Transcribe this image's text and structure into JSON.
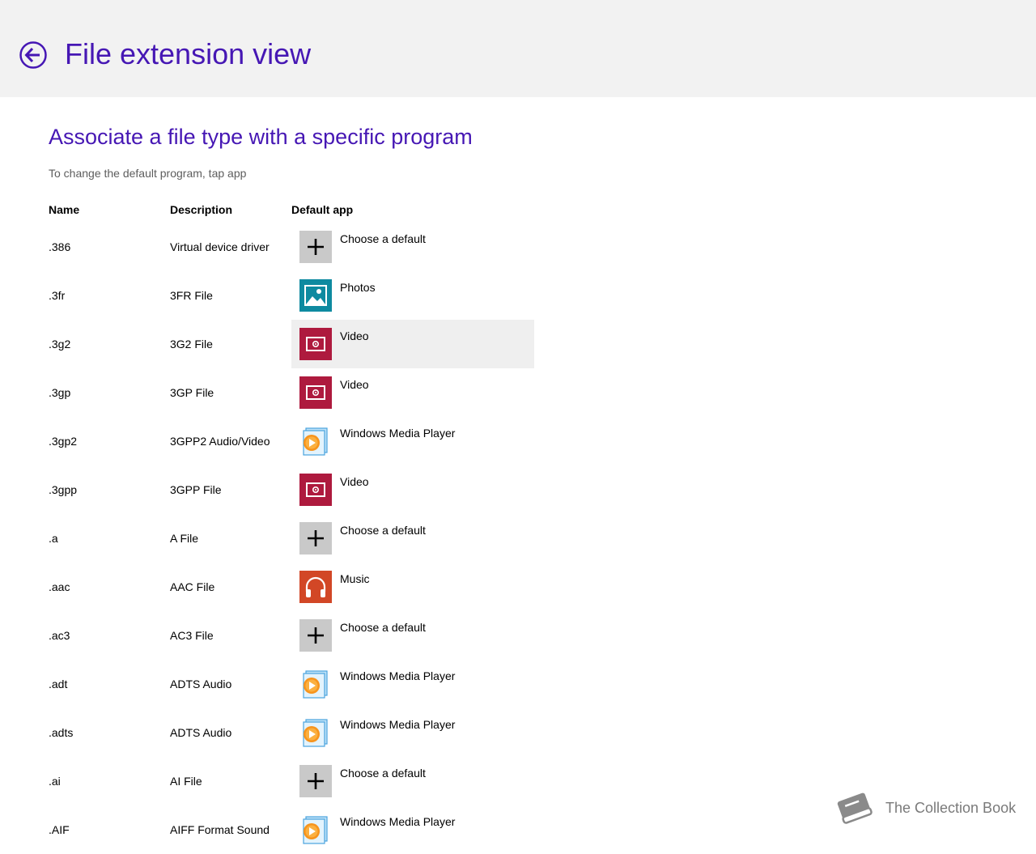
{
  "header": {
    "title": "File extension view",
    "back_icon": "back-arrow-circle-icon"
  },
  "section": {
    "title": "Associate a file type with a specific program",
    "instructions": "To change the default program, tap app"
  },
  "columns": {
    "name": "Name",
    "description": "Description",
    "default_app": "Default app"
  },
  "colors": {
    "accent": "#4617b4",
    "header_bg": "#f2f2f2",
    "video": "#ae1a3e",
    "music": "#d24726",
    "photos": "#0e8aa0",
    "choose": "#c9c9c9"
  },
  "rows": [
    {
      "name": ".386",
      "description": "Virtual device driver",
      "app": "Choose a default",
      "icon": "plus-icon"
    },
    {
      "name": ".3fr",
      "description": "3FR File",
      "app": "Photos",
      "icon": "photos-icon"
    },
    {
      "name": ".3g2",
      "description": "3G2 File",
      "app": "Video",
      "icon": "video-icon",
      "highlighted": true
    },
    {
      "name": ".3gp",
      "description": "3GP File",
      "app": "Video",
      "icon": "video-icon"
    },
    {
      "name": ".3gp2",
      "description": "3GPP2 Audio/Video",
      "app": "Windows Media Player",
      "icon": "media-player-icon"
    },
    {
      "name": ".3gpp",
      "description": "3GPP File",
      "app": "Video",
      "icon": "video-icon"
    },
    {
      "name": ".a",
      "description": "A File",
      "app": "Choose a default",
      "icon": "plus-icon"
    },
    {
      "name": ".aac",
      "description": "AAC File",
      "app": "Music",
      "icon": "music-icon"
    },
    {
      "name": ".ac3",
      "description": "AC3 File",
      "app": "Choose a default",
      "icon": "plus-icon"
    },
    {
      "name": ".adt",
      "description": "ADTS Audio",
      "app": "Windows Media Player",
      "icon": "media-player-icon"
    },
    {
      "name": ".adts",
      "description": "ADTS Audio",
      "app": "Windows Media Player",
      "icon": "media-player-icon"
    },
    {
      "name": ".ai",
      "description": "AI File",
      "app": "Choose a default",
      "icon": "plus-icon"
    },
    {
      "name": ".AIF",
      "description": "AIFF Format Sound",
      "app": "Windows Media Player",
      "icon": "media-player-icon"
    }
  ],
  "watermark": {
    "text": "The Collection Book",
    "icon": "book-icon"
  }
}
